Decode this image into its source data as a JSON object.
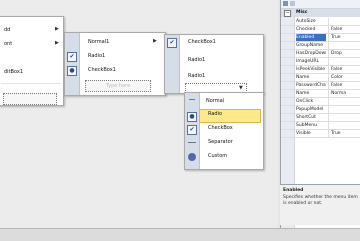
{
  "menu1": {
    "items": [
      "dd",
      "ont",
      "",
      "ditBox1"
    ]
  },
  "menu2": {
    "items": [
      "Normal1",
      "Radio1",
      "CheckBox1"
    ],
    "add_placeholder": "Type here"
  },
  "menu3": {
    "items": [
      "CheckBox1",
      "Radio1",
      "Radio1"
    ]
  },
  "dropdown": {
    "items": [
      "Normal",
      "Radio",
      "CheckBox",
      "Separator",
      "Custom"
    ],
    "selected": "Radio"
  },
  "properties": {
    "section": "Misc",
    "rows": [
      {
        "name": "AutoSize",
        "value": ""
      },
      {
        "name": "Checked",
        "value": "False"
      },
      {
        "name": "Enabled",
        "value": "True"
      },
      {
        "name": "GroupName",
        "value": ""
      },
      {
        "name": "HasDropDown",
        "value": "Drop"
      },
      {
        "name": "ImageURL",
        "value": ""
      },
      {
        "name": "IsPeekVisible",
        "value": "False"
      },
      {
        "name": "Name",
        "value": "Color"
      },
      {
        "name": "PasswordChar",
        "value": "False"
      },
      {
        "name": "Name",
        "value": "Norma"
      },
      {
        "name": "OnClick",
        "value": ""
      },
      {
        "name": "PopupModel",
        "value": ""
      },
      {
        "name": "ShortCut",
        "value": ""
      },
      {
        "name": "SubMenu",
        "value": ""
      },
      {
        "name": "Visible",
        "value": "True"
      }
    ],
    "selected_index": 2,
    "description_title": "Enabled",
    "description_text": "Specifies whether the menu item is enabled or not."
  }
}
